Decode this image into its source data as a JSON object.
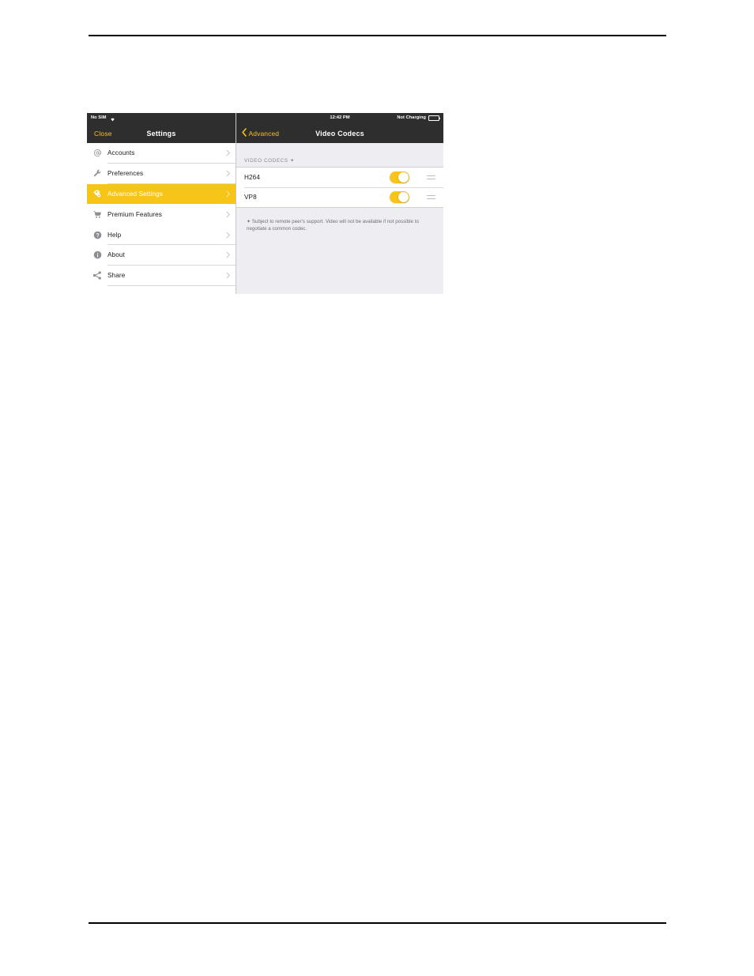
{
  "left_panel": {
    "status_bar": {
      "carrier": "No SIM",
      "wifi_icon": "wifi-icon"
    },
    "nav_bar": {
      "close_label": "Close",
      "title": "Settings"
    },
    "menu_items": [
      {
        "label": "Accounts",
        "icon": "at-sign-icon",
        "active": false
      },
      {
        "label": "Preferences",
        "icon": "wrench-icon",
        "active": false
      },
      {
        "label": "Advanced Settings",
        "icon": "gears-icon",
        "active": true
      },
      {
        "label": "Premium Features",
        "icon": "shopping-cart-icon",
        "active": false
      },
      {
        "label": "Help",
        "icon": "question-circle-icon",
        "active": false
      },
      {
        "label": "About",
        "icon": "info-circle-icon",
        "active": false
      },
      {
        "label": "Share",
        "icon": "share-icon",
        "active": false
      }
    ],
    "chevron_icon": "chevron-right-icon"
  },
  "right_panel": {
    "status_bar": {
      "time": "12:42 PM",
      "charging_status": "Not Charging",
      "battery_icon": "battery-icon"
    },
    "nav_bar": {
      "back_label": "Advanced",
      "back_icon": "chevron-left-icon",
      "title": "Video Codecs"
    },
    "section_header": "VIDEO CODECS ✦",
    "codecs": [
      {
        "name": "H264",
        "enabled": true
      },
      {
        "name": "VP8",
        "enabled": true
      }
    ],
    "footnote": "✦ Subject to remote peer's support. Video will not be available if not possible to negotiate a common codec."
  },
  "colors": {
    "accent_yellow": "#f7c518",
    "nav_bar_dark": "#2e2e2e",
    "panel_background": "#eeeef2",
    "link_yellow": "#f5c21b"
  }
}
